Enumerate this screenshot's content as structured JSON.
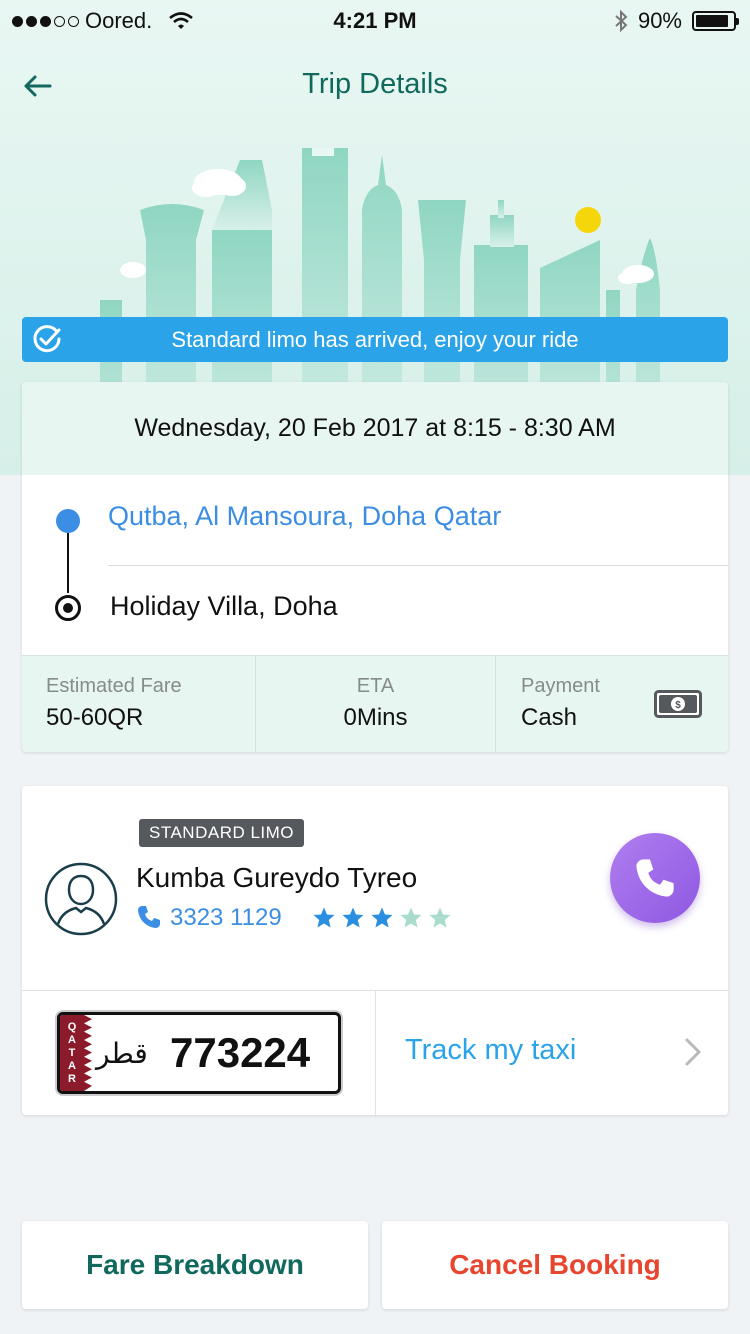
{
  "status_bar": {
    "carrier": "Oored.",
    "time": "4:21 PM",
    "battery": "90%",
    "battery_level": 0.9
  },
  "header": {
    "title": "Trip Details"
  },
  "banner": {
    "text": "Standard limo has arrived, enjoy your ride"
  },
  "trip": {
    "datetime": "Wednesday, 20 Feb 2017 at 8:15 - 8:30 AM",
    "pickup": "Qutba, Al Mansoura, Doha Qatar",
    "dropoff": "Holiday Villa, Doha",
    "fare_label": "Estimated Fare",
    "fare_value": "50-60QR",
    "eta_label": "ETA",
    "eta_value": "0Mins",
    "payment_label": "Payment",
    "payment_value": "Cash"
  },
  "driver": {
    "badge": "STANDARD LIMO",
    "name": "Kumba Gureydo Tyreo",
    "phone": "3323 1129",
    "rating": 3,
    "rating_max": 5,
    "plate_country": "QATAR",
    "plate_arabic": "قطر",
    "plate_number": "773224",
    "track_label": "Track my taxi"
  },
  "actions": {
    "fare_breakdown": "Fare Breakdown",
    "cancel_booking": "Cancel Booking"
  },
  "colors": {
    "primary": "#11695d",
    "accent_blue": "#2aa3e9",
    "link_blue": "#3b8ee3",
    "danger": "#e8452f",
    "call_purple": "#9b67e8",
    "skyline": "#8fd6c2",
    "sun": "#f5d60a"
  },
  "icons": {
    "back": "arrow-left-icon",
    "banner": "check-circle-icon",
    "payment": "cash-icon",
    "avatar": "user-avatar-icon",
    "phone": "phone-icon",
    "call": "phone-call-icon",
    "track": "chevron-right-icon"
  }
}
